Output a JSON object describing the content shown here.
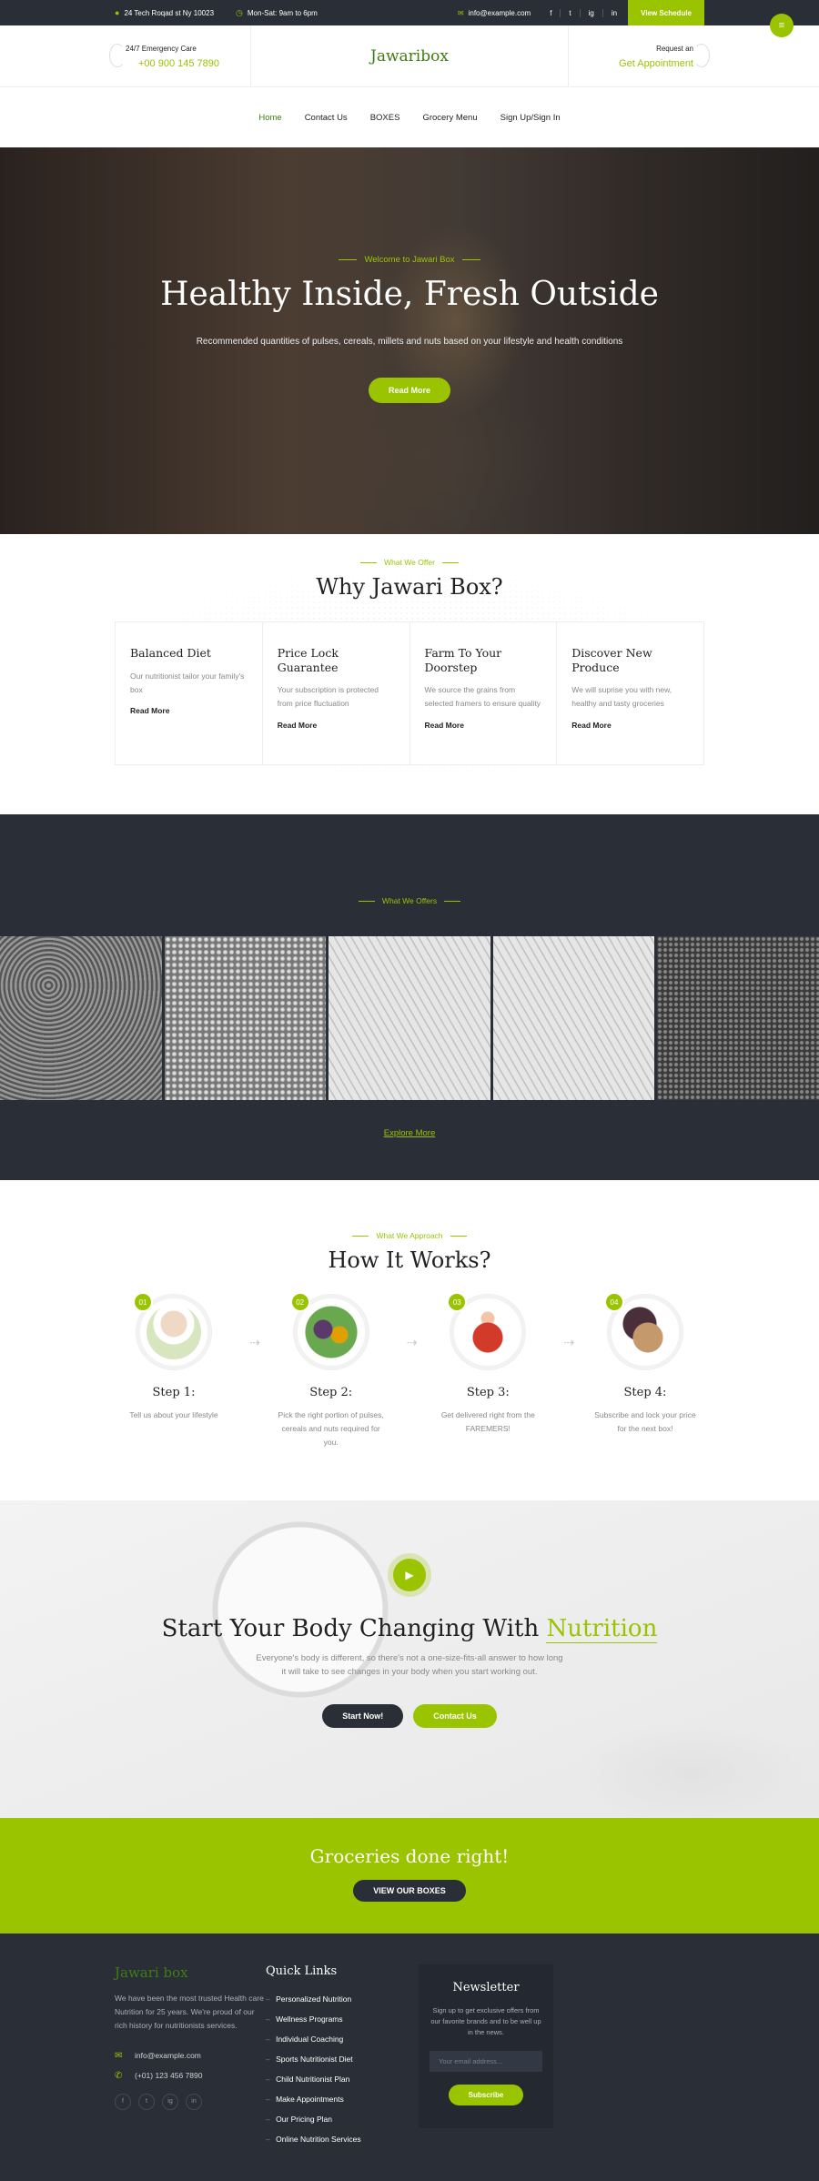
{
  "topbar": {
    "address": "24 Tech Roqad st Ny 10023",
    "hours": "Mon-Sat: 9am to 6pm",
    "email": "info@example.com",
    "social": [
      "f",
      "t",
      "ig",
      "in"
    ],
    "schedule_btn": "View Schedule"
  },
  "header": {
    "emergency_label": "24/7 Emergency Care",
    "phone": "+00 900 145 7890",
    "brand": "Jawaribox",
    "request_label": "Request an",
    "appointment": "Get Appointment"
  },
  "nav": [
    "Home",
    "Contact Us",
    "BOXES",
    "Grocery Menu",
    "Sign Up/Sign In"
  ],
  "hero": {
    "subtitle": "Welcome to Jawari Box",
    "title": "Healthy Inside, Fresh Outside",
    "description": "Recommended quantities of pulses, cereals, millets and nuts based on your lifestyle and health conditions",
    "button": "Read More"
  },
  "why": {
    "subtitle": "What We Offer",
    "title": "Why Jawari Box?",
    "cards": [
      {
        "title": "Balanced Diet",
        "text": "Our nutritionist tailor your family's box",
        "link": "Read More"
      },
      {
        "title": "Price Lock Guarantee",
        "text": "Your subscription is protected from price fluctuation",
        "link": "Read More"
      },
      {
        "title": "Farm To Your Doorstep",
        "text": "We source the grains from selected framers to ensure quality",
        "link": "Read More"
      },
      {
        "title": "Discover New Produce",
        "text": "We will suprise you with new, healthy and tasty groceries",
        "link": "Read More"
      }
    ]
  },
  "offers": {
    "subtitle": "What We Offers",
    "link": "Explore More"
  },
  "how": {
    "subtitle": "What We Approach",
    "title": "How It Works?",
    "steps": [
      {
        "num": "01",
        "title": "Step 1:",
        "text": "Tell us about your lifestyle"
      },
      {
        "num": "02",
        "title": "Step 2:",
        "text": "Pick the right portion of pulses, cereals and nuts required for you."
      },
      {
        "num": "03",
        "title": "Step 3:",
        "text": "Get delivered right from the FAREMERS!"
      },
      {
        "num": "04",
        "title": "Step 4:",
        "text": "Subscribe and lock your price for the next box!"
      }
    ]
  },
  "cta": {
    "title_main": "Start Your Body Changing With",
    "title_accent": "Nutrition",
    "text": "Everyone's body is different, so there's not a one-size-fits-all answer to how long it will take to see changes in your body when you start working out.",
    "btn_start": "Start Now!",
    "btn_contact": "Contact Us"
  },
  "groceries": {
    "title": "Groceries done right!",
    "button": "VIEW OUR BOXES"
  },
  "footer": {
    "brand": "Jawari box",
    "about": "We have been the most trusted Health care Nutrition for 25 years. We're proud of our rich history for nutritionists services.",
    "email": "info@example.com",
    "phone": "(+01) 123 456 7890",
    "social": [
      "f",
      "t",
      "ig",
      "in"
    ],
    "links_title": "Quick Links",
    "links": [
      "Personalized Nutrition",
      "Wellness Programs",
      "Individual Coaching",
      "Sports Nutritionist Diet",
      "Child Nutritionist Plan",
      "Make Appointments",
      "Our Pricing Plan",
      "Online Nutrition Services"
    ],
    "newsletter_title": "Newsletter",
    "newsletter_text": "Sign up to get exclusive offers from our favorite brands and to be well up in the news.",
    "newsletter_placeholder": "Your email address...",
    "subscribe": "Subscribe"
  },
  "colors": {
    "accent": "#9ac400",
    "dark": "#2a2f37",
    "brand_green": "#3f7d12"
  }
}
